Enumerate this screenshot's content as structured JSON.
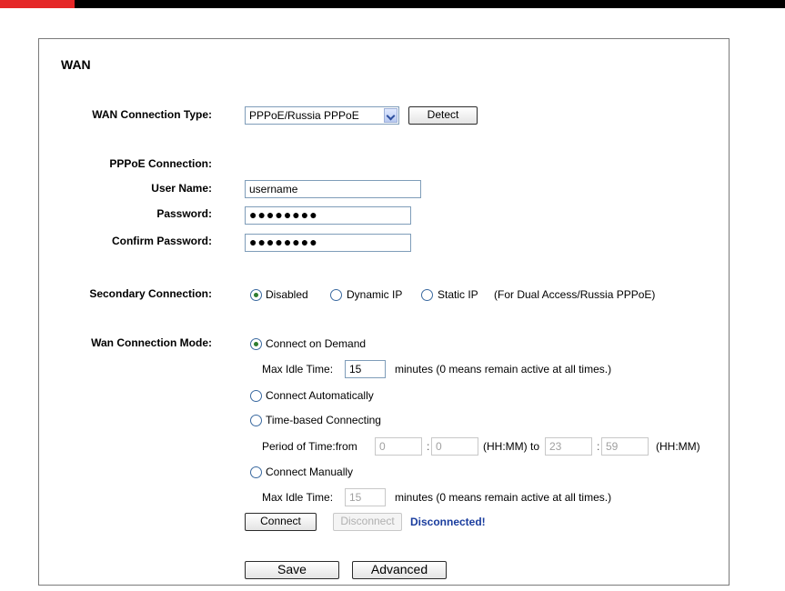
{
  "page": {
    "title": "WAN"
  },
  "labels": {
    "wan_connection_type": "WAN Connection Type:",
    "pppoe_connection": "PPPoE Connection:",
    "user_name": "User Name:",
    "password": "Password:",
    "confirm_password": "Confirm Password:",
    "secondary_connection": "Secondary Connection:",
    "wan_connection_mode": "Wan Connection Mode:"
  },
  "wan_type": {
    "selected": "PPPoE/Russia PPPoE",
    "detect_label": "Detect"
  },
  "fields": {
    "user_name": "username",
    "password": "●●●●●●●●",
    "confirm_password": "●●●●●●●●"
  },
  "secondary": {
    "options": [
      "Disabled",
      "Dynamic IP",
      "Static IP"
    ],
    "selected": "Disabled",
    "note": "(For Dual Access/Russia PPPoE)"
  },
  "mode": {
    "selected": "Connect on Demand",
    "on_demand": {
      "label": "Connect on Demand",
      "idle_label": "Max Idle Time:",
      "idle_value": "15",
      "idle_suffix": "minutes (0 means remain active at all times.)"
    },
    "automatic": {
      "label": "Connect Automatically"
    },
    "time_based": {
      "label": "Time-based Connecting",
      "period_label": "Period of Time:from",
      "from_hh": "0",
      "from_mm": "0",
      "to_label": "(HH:MM) to",
      "to_hh": "23",
      "to_mm": "59",
      "end_label": "(HH:MM)",
      "colon": ":"
    },
    "manual": {
      "label": "Connect Manually",
      "idle_label": "Max Idle Time:",
      "idle_value": "15",
      "idle_suffix": "minutes (0 means remain active at all times.)"
    }
  },
  "connect": {
    "connect_label": "Connect",
    "disconnect_label": "Disconnect",
    "status": "Disconnected!"
  },
  "actions": {
    "save_label": "Save",
    "advanced_label": "Advanced"
  },
  "colors": {
    "accent_red": "#e52727",
    "status_blue": "#1a3d9e"
  }
}
